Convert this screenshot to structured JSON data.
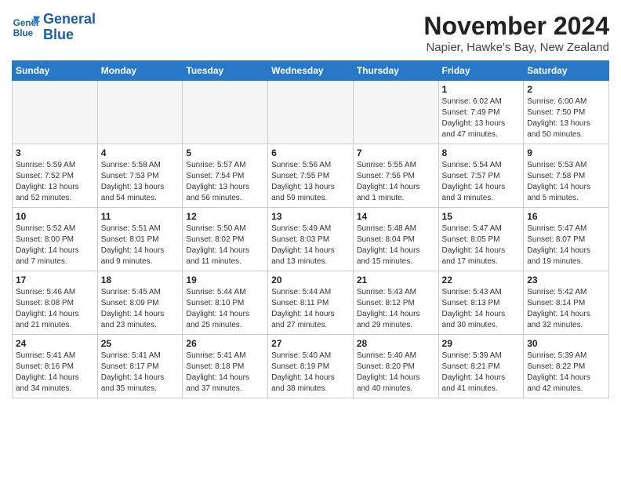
{
  "logo": {
    "line1": "General",
    "line2": "Blue"
  },
  "title": "November 2024",
  "subtitle": "Napier, Hawke's Bay, New Zealand",
  "headers": [
    "Sunday",
    "Monday",
    "Tuesday",
    "Wednesday",
    "Thursday",
    "Friday",
    "Saturday"
  ],
  "weeks": [
    [
      {
        "num": "",
        "info": "",
        "empty": true
      },
      {
        "num": "",
        "info": "",
        "empty": true
      },
      {
        "num": "",
        "info": "",
        "empty": true
      },
      {
        "num": "",
        "info": "",
        "empty": true
      },
      {
        "num": "",
        "info": "",
        "empty": true
      },
      {
        "num": "1",
        "info": "Sunrise: 6:02 AM\nSunset: 7:49 PM\nDaylight: 13 hours\nand 47 minutes.",
        "empty": false
      },
      {
        "num": "2",
        "info": "Sunrise: 6:00 AM\nSunset: 7:50 PM\nDaylight: 13 hours\nand 50 minutes.",
        "empty": false
      }
    ],
    [
      {
        "num": "3",
        "info": "Sunrise: 5:59 AM\nSunset: 7:52 PM\nDaylight: 13 hours\nand 52 minutes.",
        "empty": false
      },
      {
        "num": "4",
        "info": "Sunrise: 5:58 AM\nSunset: 7:53 PM\nDaylight: 13 hours\nand 54 minutes.",
        "empty": false
      },
      {
        "num": "5",
        "info": "Sunrise: 5:57 AM\nSunset: 7:54 PM\nDaylight: 13 hours\nand 56 minutes.",
        "empty": false
      },
      {
        "num": "6",
        "info": "Sunrise: 5:56 AM\nSunset: 7:55 PM\nDaylight: 13 hours\nand 59 minutes.",
        "empty": false
      },
      {
        "num": "7",
        "info": "Sunrise: 5:55 AM\nSunset: 7:56 PM\nDaylight: 14 hours\nand 1 minute.",
        "empty": false
      },
      {
        "num": "8",
        "info": "Sunrise: 5:54 AM\nSunset: 7:57 PM\nDaylight: 14 hours\nand 3 minutes.",
        "empty": false
      },
      {
        "num": "9",
        "info": "Sunrise: 5:53 AM\nSunset: 7:58 PM\nDaylight: 14 hours\nand 5 minutes.",
        "empty": false
      }
    ],
    [
      {
        "num": "10",
        "info": "Sunrise: 5:52 AM\nSunset: 8:00 PM\nDaylight: 14 hours\nand 7 minutes.",
        "empty": false
      },
      {
        "num": "11",
        "info": "Sunrise: 5:51 AM\nSunset: 8:01 PM\nDaylight: 14 hours\nand 9 minutes.",
        "empty": false
      },
      {
        "num": "12",
        "info": "Sunrise: 5:50 AM\nSunset: 8:02 PM\nDaylight: 14 hours\nand 11 minutes.",
        "empty": false
      },
      {
        "num": "13",
        "info": "Sunrise: 5:49 AM\nSunset: 8:03 PM\nDaylight: 14 hours\nand 13 minutes.",
        "empty": false
      },
      {
        "num": "14",
        "info": "Sunrise: 5:48 AM\nSunset: 8:04 PM\nDaylight: 14 hours\nand 15 minutes.",
        "empty": false
      },
      {
        "num": "15",
        "info": "Sunrise: 5:47 AM\nSunset: 8:05 PM\nDaylight: 14 hours\nand 17 minutes.",
        "empty": false
      },
      {
        "num": "16",
        "info": "Sunrise: 5:47 AM\nSunset: 8:07 PM\nDaylight: 14 hours\nand 19 minutes.",
        "empty": false
      }
    ],
    [
      {
        "num": "17",
        "info": "Sunrise: 5:46 AM\nSunset: 8:08 PM\nDaylight: 14 hours\nand 21 minutes.",
        "empty": false
      },
      {
        "num": "18",
        "info": "Sunrise: 5:45 AM\nSunset: 8:09 PM\nDaylight: 14 hours\nand 23 minutes.",
        "empty": false
      },
      {
        "num": "19",
        "info": "Sunrise: 5:44 AM\nSunset: 8:10 PM\nDaylight: 14 hours\nand 25 minutes.",
        "empty": false
      },
      {
        "num": "20",
        "info": "Sunrise: 5:44 AM\nSunset: 8:11 PM\nDaylight: 14 hours\nand 27 minutes.",
        "empty": false
      },
      {
        "num": "21",
        "info": "Sunrise: 5:43 AM\nSunset: 8:12 PM\nDaylight: 14 hours\nand 29 minutes.",
        "empty": false
      },
      {
        "num": "22",
        "info": "Sunrise: 5:43 AM\nSunset: 8:13 PM\nDaylight: 14 hours\nand 30 minutes.",
        "empty": false
      },
      {
        "num": "23",
        "info": "Sunrise: 5:42 AM\nSunset: 8:14 PM\nDaylight: 14 hours\nand 32 minutes.",
        "empty": false
      }
    ],
    [
      {
        "num": "24",
        "info": "Sunrise: 5:41 AM\nSunset: 8:16 PM\nDaylight: 14 hours\nand 34 minutes.",
        "empty": false
      },
      {
        "num": "25",
        "info": "Sunrise: 5:41 AM\nSunset: 8:17 PM\nDaylight: 14 hours\nand 35 minutes.",
        "empty": false
      },
      {
        "num": "26",
        "info": "Sunrise: 5:41 AM\nSunset: 8:18 PM\nDaylight: 14 hours\nand 37 minutes.",
        "empty": false
      },
      {
        "num": "27",
        "info": "Sunrise: 5:40 AM\nSunset: 8:19 PM\nDaylight: 14 hours\nand 38 minutes.",
        "empty": false
      },
      {
        "num": "28",
        "info": "Sunrise: 5:40 AM\nSunset: 8:20 PM\nDaylight: 14 hours\nand 40 minutes.",
        "empty": false
      },
      {
        "num": "29",
        "info": "Sunrise: 5:39 AM\nSunset: 8:21 PM\nDaylight: 14 hours\nand 41 minutes.",
        "empty": false
      },
      {
        "num": "30",
        "info": "Sunrise: 5:39 AM\nSunset: 8:22 PM\nDaylight: 14 hours\nand 42 minutes.",
        "empty": false
      }
    ]
  ]
}
